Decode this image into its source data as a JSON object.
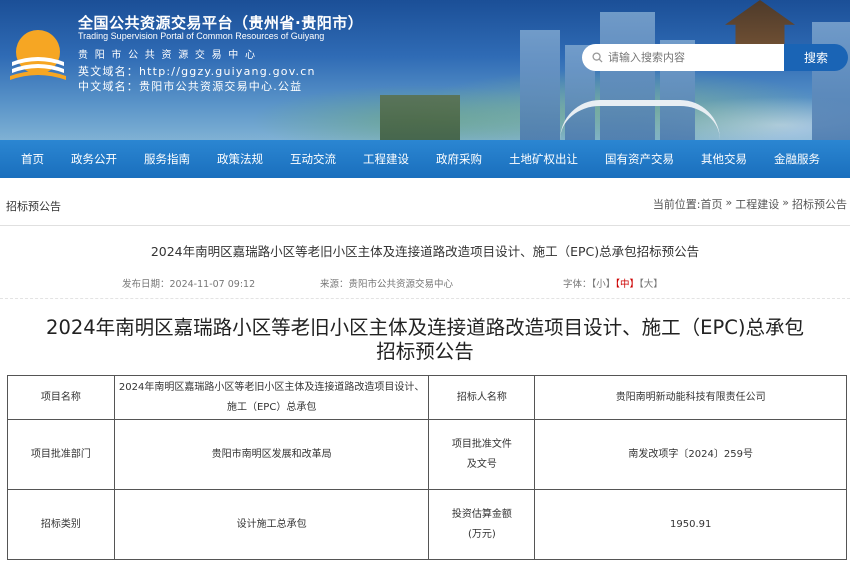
{
  "header": {
    "title_zh": "全国公共资源交易平台（贵州省·贵阳市）",
    "title_en": "Trading Supervision Portal of Common Resources of Guiyang",
    "subtitle": "贵阳市公共资源交易中心",
    "en_domain": "英文域名：http://ggzy.guiyang.gov.cn",
    "zh_domain": "中文域名：贵阳市公共资源交易中心.公益",
    "search_placeholder": "请输入搜索内容",
    "search_button": "搜索"
  },
  "nav": [
    "首页",
    "政务公开",
    "服务指南",
    "政策法规",
    "互动交流",
    "工程建设",
    "政府采购",
    "土地矿权出让",
    "国有资产交易",
    "其他交易",
    "金融服务"
  ],
  "breadcrumb": {
    "section_title": "招标预公告",
    "prefix": "当前位置:",
    "items": [
      "首页",
      "»",
      "工程建设",
      "»",
      "招标预公告"
    ]
  },
  "article": {
    "title": "2024年南明区嘉瑞路小区等老旧小区主体及连接道路改造项目设计、施工（EPC)总承包招标预公告",
    "publish_date": "发布日期：2024-11-07 09:12",
    "source": "来源：贵阳市公共资源交易中心",
    "font_label": "字体：",
    "font_small": "【小】",
    "font_mid": "【中】",
    "font_large": "【大】",
    "big_title_line1": "2024年南明区嘉瑞路小区等老旧小区主体及连接道路改造项目设计、施工（EPC)总承包",
    "big_title_line2": "招标预公告"
  },
  "table": {
    "r1": [
      "项目名称",
      "2024年南明区嘉瑞路小区等老旧小区主体及连接道路改造项目设计、施工（EPC）总承包",
      "招标人名称",
      "贵阳南明新动能科技有限责任公司"
    ],
    "r2": [
      "项目批准部门",
      "贵阳市南明区发展和改革局",
      "项目批准文件及文号",
      "南发改项字〔2024〕259号"
    ],
    "r3": [
      "招标类别",
      "设计施工总承包",
      "投资估算金额(万元)",
      "1950.91"
    ]
  }
}
